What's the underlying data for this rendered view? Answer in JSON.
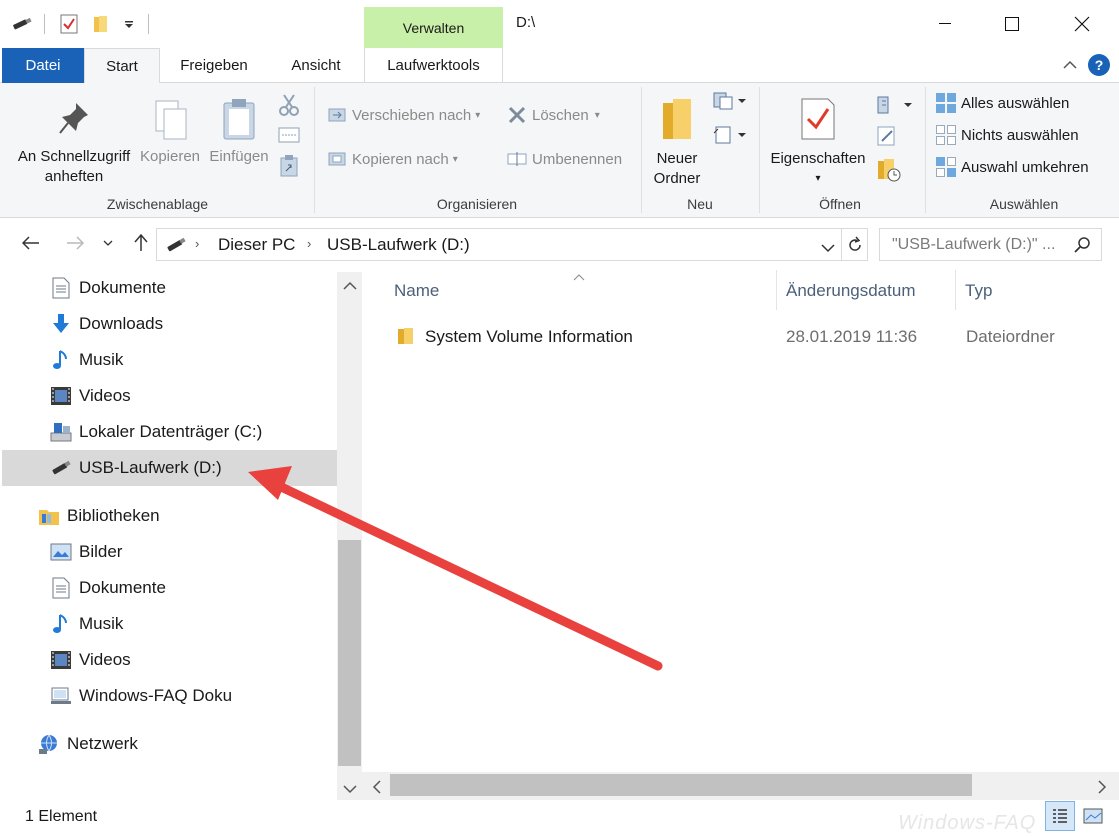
{
  "titlebar": {
    "window_title": "D:\\",
    "contextual_tab": "Verwalten",
    "minimize_label": "",
    "maximize_label": "",
    "close_label": ""
  },
  "tabs": [
    {
      "label": "Datei"
    },
    {
      "label": "Start"
    },
    {
      "label": "Freigeben"
    },
    {
      "label": "Ansicht"
    },
    {
      "label": "Laufwerktools"
    }
  ],
  "ribbon": {
    "zwischenablage": {
      "label": "Zwischenablage",
      "pin_line1": "An Schnellzugriff",
      "pin_line2": "anheften",
      "copy": "Kopieren",
      "paste": "Einfügen"
    },
    "organisieren": {
      "label": "Organisieren",
      "move_to": "Verschieben nach",
      "copy_to": "Kopieren nach",
      "delete": "Löschen",
      "rename": "Umbenennen"
    },
    "neu": {
      "label": "Neu",
      "new_folder_line1": "Neuer",
      "new_folder_line2": "Ordner"
    },
    "oeffnen": {
      "label": "Öffnen",
      "properties": "Eigenschaften"
    },
    "auswaehlen": {
      "label": "Auswählen",
      "select_all": "Alles auswählen",
      "select_none": "Nichts auswählen",
      "invert": "Auswahl umkehren"
    }
  },
  "address": {
    "crumb1": "Dieser PC",
    "crumb2": "USB-Laufwerk (D:)",
    "search_placeholder": "\"USB-Laufwerk (D:)\" ..."
  },
  "nav": {
    "items": [
      {
        "label": "Dokumente",
        "icon": "document-icon"
      },
      {
        "label": "Downloads",
        "icon": "download-icon"
      },
      {
        "label": "Musik",
        "icon": "music-icon"
      },
      {
        "label": "Videos",
        "icon": "video-icon"
      },
      {
        "label": "Lokaler Datenträger (C:)",
        "icon": "drive-icon"
      },
      {
        "label": "USB-Laufwerk (D:)",
        "icon": "usb-drive-icon"
      },
      {
        "label": "Bibliotheken",
        "icon": "library-icon"
      },
      {
        "label": "Bilder",
        "icon": "pictures-icon"
      },
      {
        "label": "Dokumente",
        "icon": "document-icon"
      },
      {
        "label": "Musik",
        "icon": "music-icon"
      },
      {
        "label": "Videos",
        "icon": "video-icon"
      },
      {
        "label": "Windows-FAQ Doku",
        "icon": "library-icon"
      },
      {
        "label": "Netzwerk",
        "icon": "network-icon"
      }
    ]
  },
  "files": {
    "columns": [
      "Name",
      "Änderungsdatum",
      "Typ"
    ],
    "rows": [
      {
        "name": "System Volume Information",
        "date": "28.01.2019 11:36",
        "type": "Dateiordner"
      }
    ]
  },
  "status": {
    "text": "1 Element"
  },
  "watermark": "Windows-FAQ",
  "colors": {
    "accent": "#1a62b8",
    "contextual_tab": "#c9f0a8",
    "selection": "#d9d9d9",
    "annotation_arrow": "#f04040"
  }
}
